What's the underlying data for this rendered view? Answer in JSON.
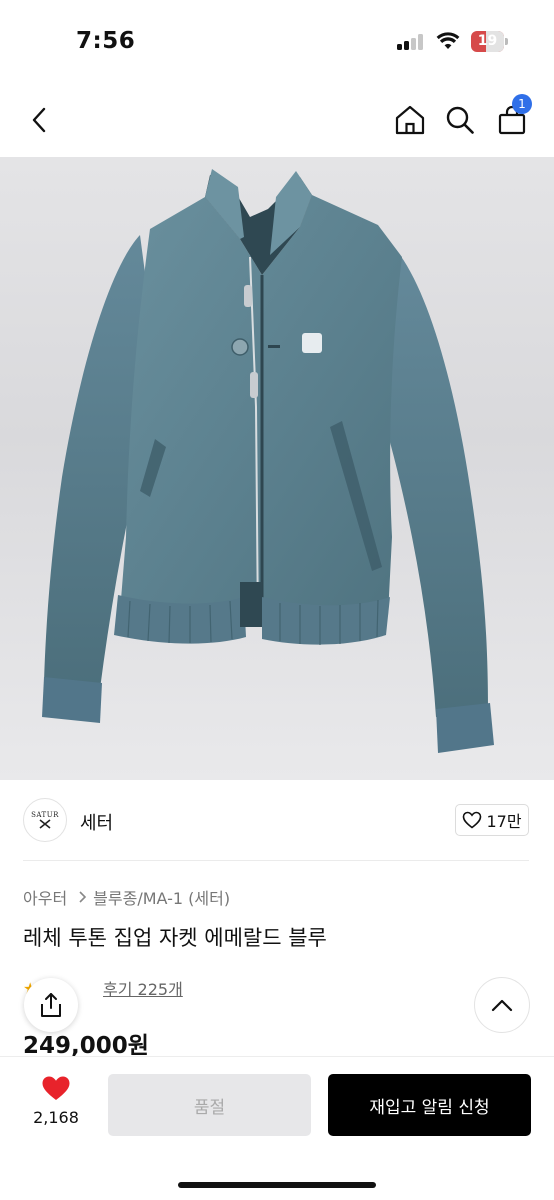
{
  "status_bar": {
    "time": "7:56",
    "battery_level": "19",
    "icons": [
      "signal-icon",
      "wifi-icon",
      "battery-icon"
    ]
  },
  "header": {
    "icons": [
      "back-icon",
      "home-icon",
      "search-icon",
      "cart-icon"
    ],
    "cart_count": "1",
    "badge_color": "#2f6fe8"
  },
  "product_image": {
    "description_icon": "jacket-image",
    "colors": {
      "jacket": "#5f8593",
      "jacket_shadow": "#3f5e6a",
      "background": "#dcdcdf"
    }
  },
  "brand": {
    "logo_text": "SATUR",
    "name": "세터",
    "like_count": "17만"
  },
  "breadcrumb": {
    "level1": "아우터",
    "level2": "블루종/MA-1 (세터)"
  },
  "product": {
    "title": "레체 투톤 집업 자켓 에메랄드 블루",
    "review_link": "후기 225개",
    "price": "249,000원"
  },
  "actions": {
    "wish_count": "2,168",
    "soldout_label": "품절",
    "restock_label": "재입고 알림 신청",
    "heart_color": "#e8232b"
  }
}
